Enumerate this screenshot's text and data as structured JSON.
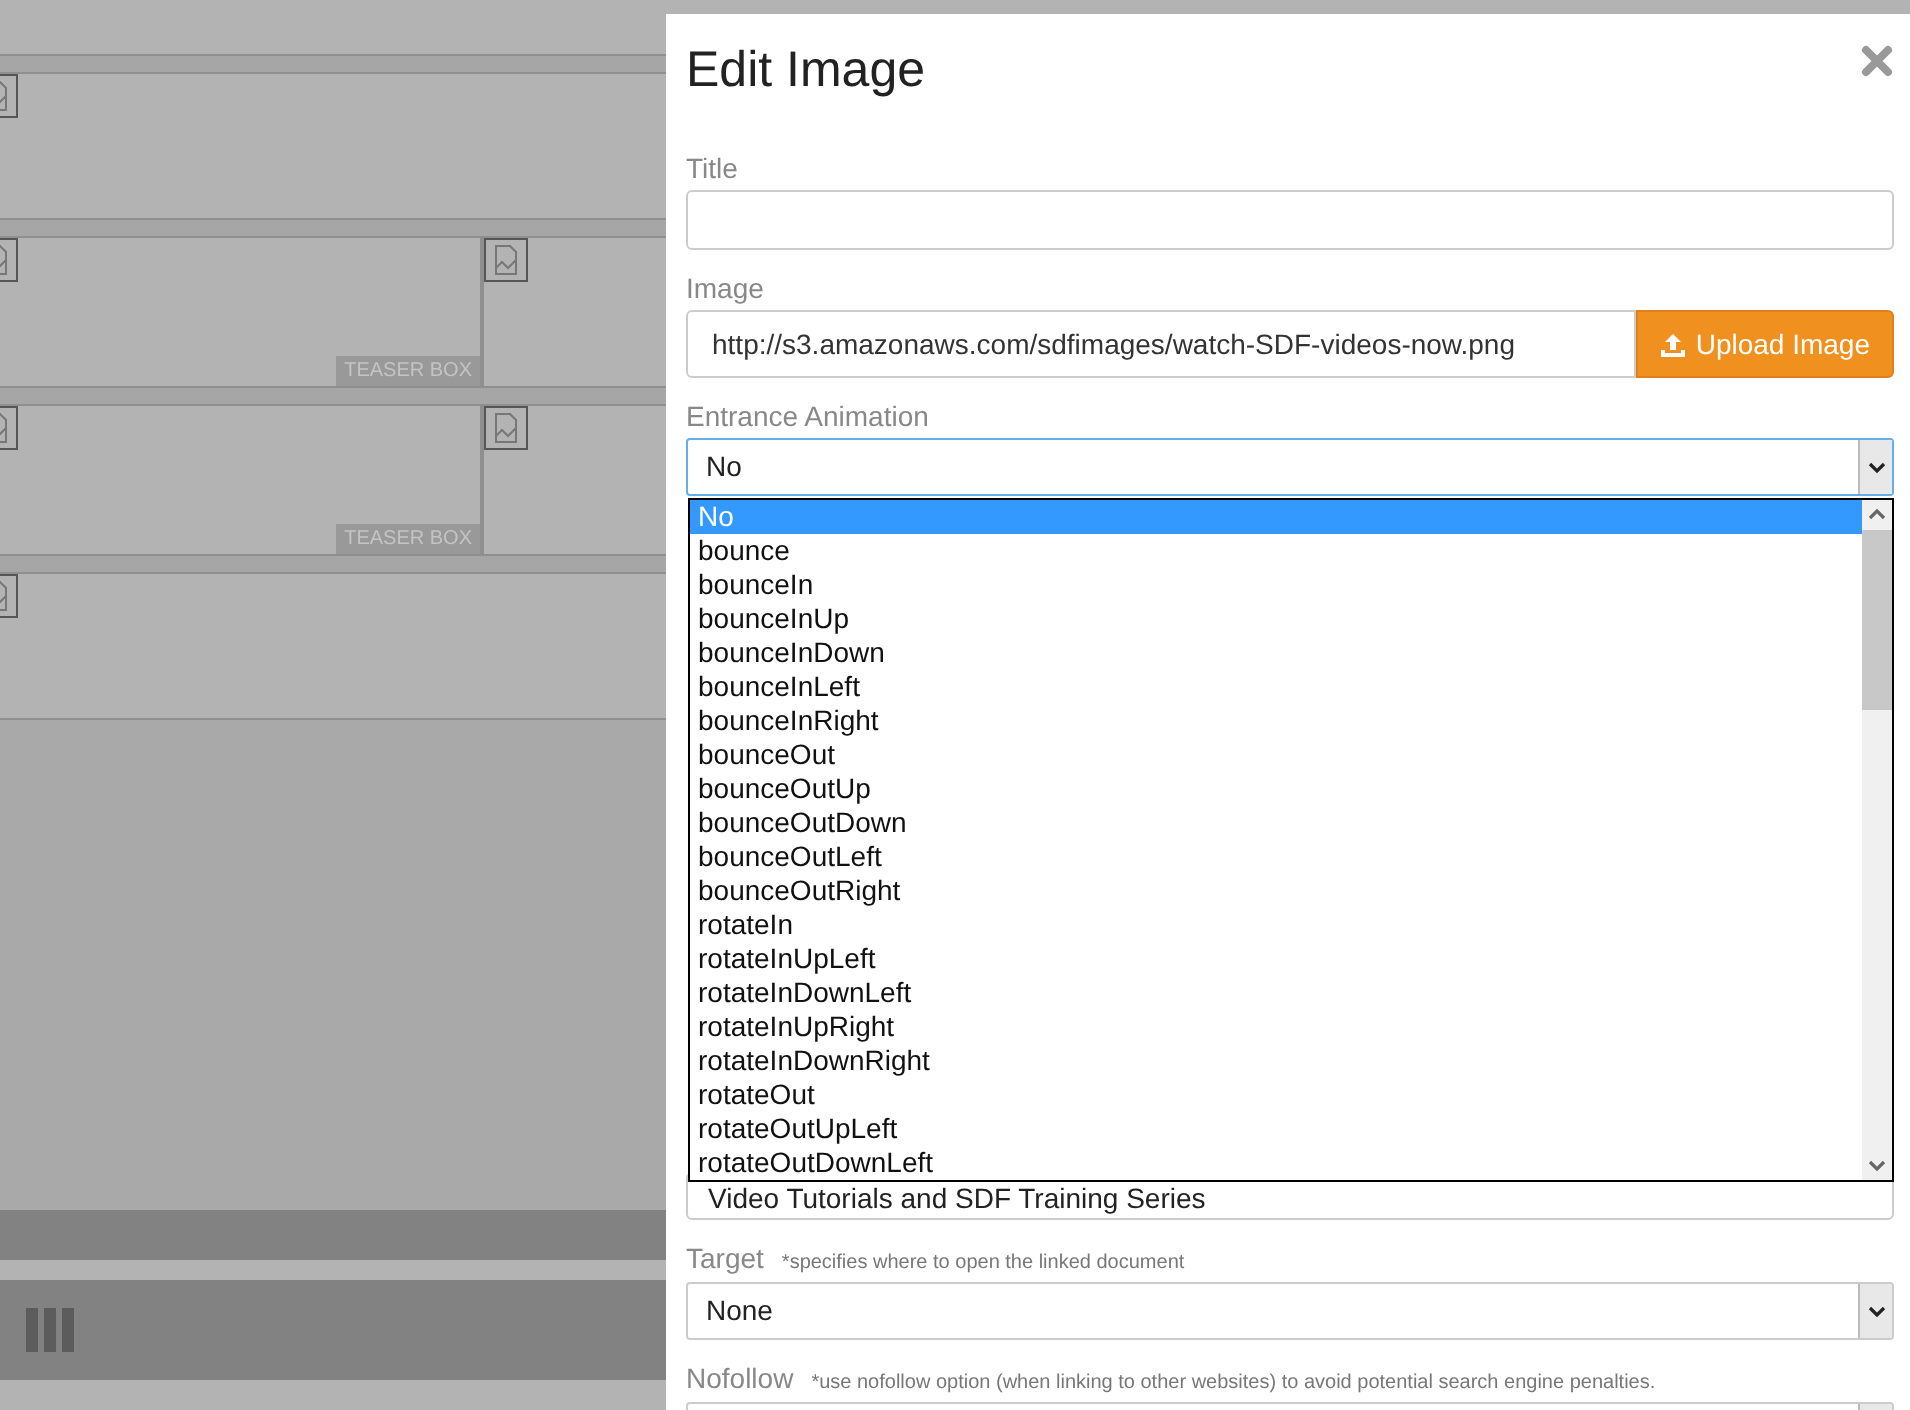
{
  "background": {
    "blocks": [
      {
        "kind": "full"
      },
      {
        "kind": "split",
        "label": "TEASER BOX"
      },
      {
        "kind": "split",
        "label": "TEASER BOX"
      },
      {
        "kind": "full"
      }
    ],
    "has_footer_bar": true
  },
  "dialog": {
    "title": "Edit Image",
    "fields": [
      {
        "kind": "text",
        "label": "Title"
      },
      {
        "kind": "upload",
        "label": "Image",
        "value": "http://s3.amazonaws.com/sdfimages/watch-SDF-videos-now.png",
        "button": "Upload Image"
      },
      {
        "kind": "select",
        "label": "Entrance Animation",
        "value": "No",
        "expanded": true,
        "options": [
          {
            "label": "No",
            "selected": true
          },
          {
            "label": "bounce",
            "selected": false
          },
          {
            "label": "bounceIn",
            "selected": false
          },
          {
            "label": "bounceInUp",
            "selected": false
          },
          {
            "label": "bounceInDown",
            "selected": false
          },
          {
            "label": "bounceInLeft",
            "selected": false
          },
          {
            "label": "bounceInRight",
            "selected": false
          },
          {
            "label": "bounceOut",
            "selected": false
          },
          {
            "label": "bounceOutUp",
            "selected": false
          },
          {
            "label": "bounceOutDown",
            "selected": false
          },
          {
            "label": "bounceOutLeft",
            "selected": false
          },
          {
            "label": "bounceOutRight",
            "selected": false
          },
          {
            "label": "rotateIn",
            "selected": false
          },
          {
            "label": "rotateInUpLeft",
            "selected": false
          },
          {
            "label": "rotateInDownLeft",
            "selected": false
          },
          {
            "label": "rotateInUpRight",
            "selected": false
          },
          {
            "label": "rotateInDownRight",
            "selected": false
          },
          {
            "label": "rotateOut",
            "selected": false
          },
          {
            "label": "rotateOutUpLeft",
            "selected": false
          },
          {
            "label": "rotateOutDownLeft",
            "selected": false
          }
        ]
      },
      {
        "kind": "text",
        "value": "Video Tutorials and SDF Training Series"
      },
      {
        "kind": "select",
        "label": "Target",
        "hint": "*specifies where to open the linked document",
        "value": "None"
      },
      {
        "kind": "select",
        "label": "Nofollow",
        "hint": "*use nofollow option (when linking to other websites) to avoid potential search engine penalties."
      }
    ]
  }
}
